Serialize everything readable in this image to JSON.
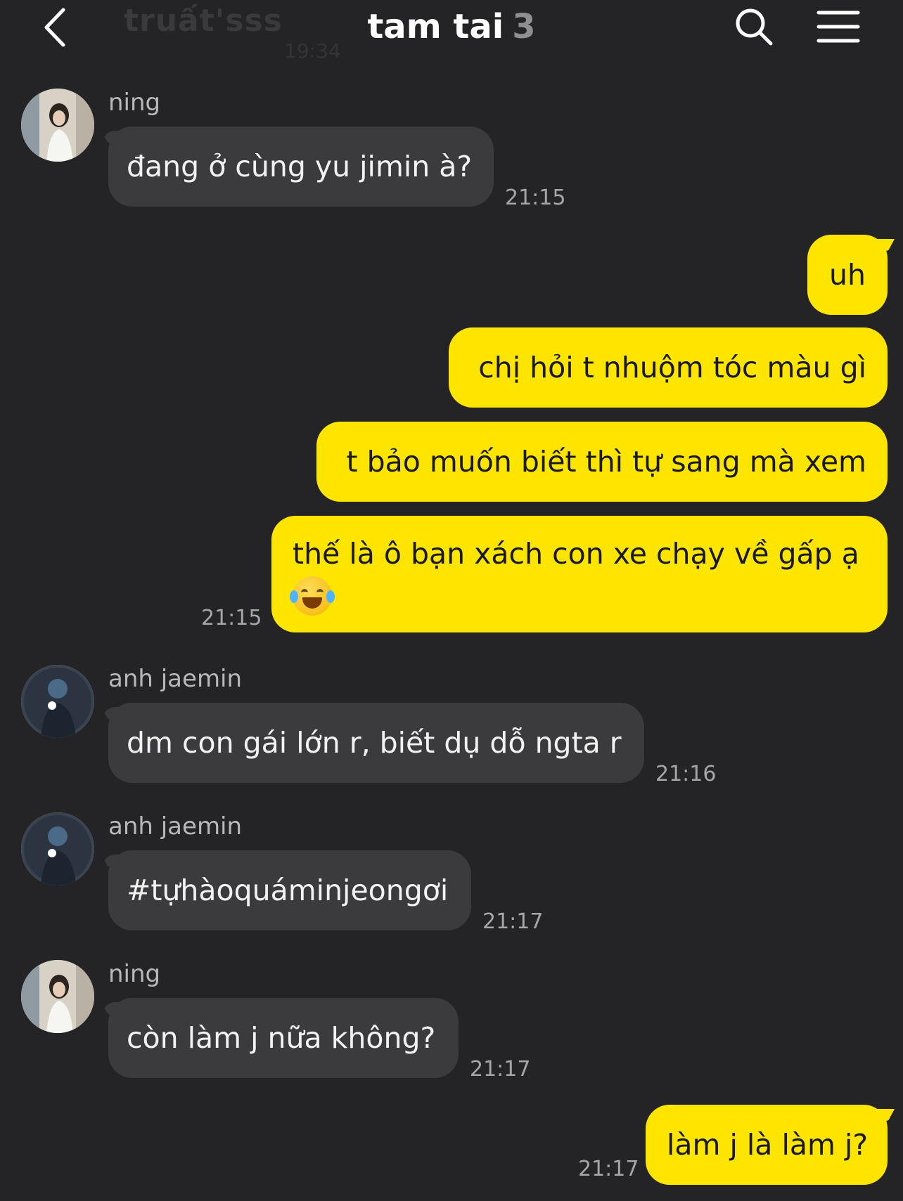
{
  "header": {
    "title": "tam tai",
    "member_count": "3",
    "ghost_title": "truất'sss",
    "ghost_time": "19:34"
  },
  "messages": [
    {
      "sender": "ning",
      "text": "đang ở cùng yu jimin à?",
      "time": "21:15",
      "direction": "in"
    },
    {
      "direction": "out",
      "text": "uh"
    },
    {
      "direction": "out",
      "text": "chị hỏi t nhuộm tóc màu gì"
    },
    {
      "direction": "out",
      "text": "t bảo muốn biết thì tự sang mà xem"
    },
    {
      "direction": "out",
      "text": "thế là ô bạn xách con xe chạy về gấp ạ",
      "emoji": "face-with-tears-of-joy",
      "time": "21:15"
    },
    {
      "sender": "anh jaemin",
      "text": "dm con gái lớn r, biết dụ dỗ ngta r",
      "time": "21:16",
      "direction": "in"
    },
    {
      "sender": "anh jaemin",
      "text": "#tựhàoquáminjeongơi",
      "time": "21:17",
      "direction": "in"
    },
    {
      "sender": "ning",
      "text": "còn làm j nữa không?",
      "time": "21:17",
      "direction": "in"
    },
    {
      "direction": "out",
      "text": "làm j là làm j?",
      "time": "21:17"
    }
  ],
  "colors": {
    "background": "#242426",
    "incoming_bubble": "#3b3b3e",
    "outgoing_bubble": "#fee500"
  }
}
